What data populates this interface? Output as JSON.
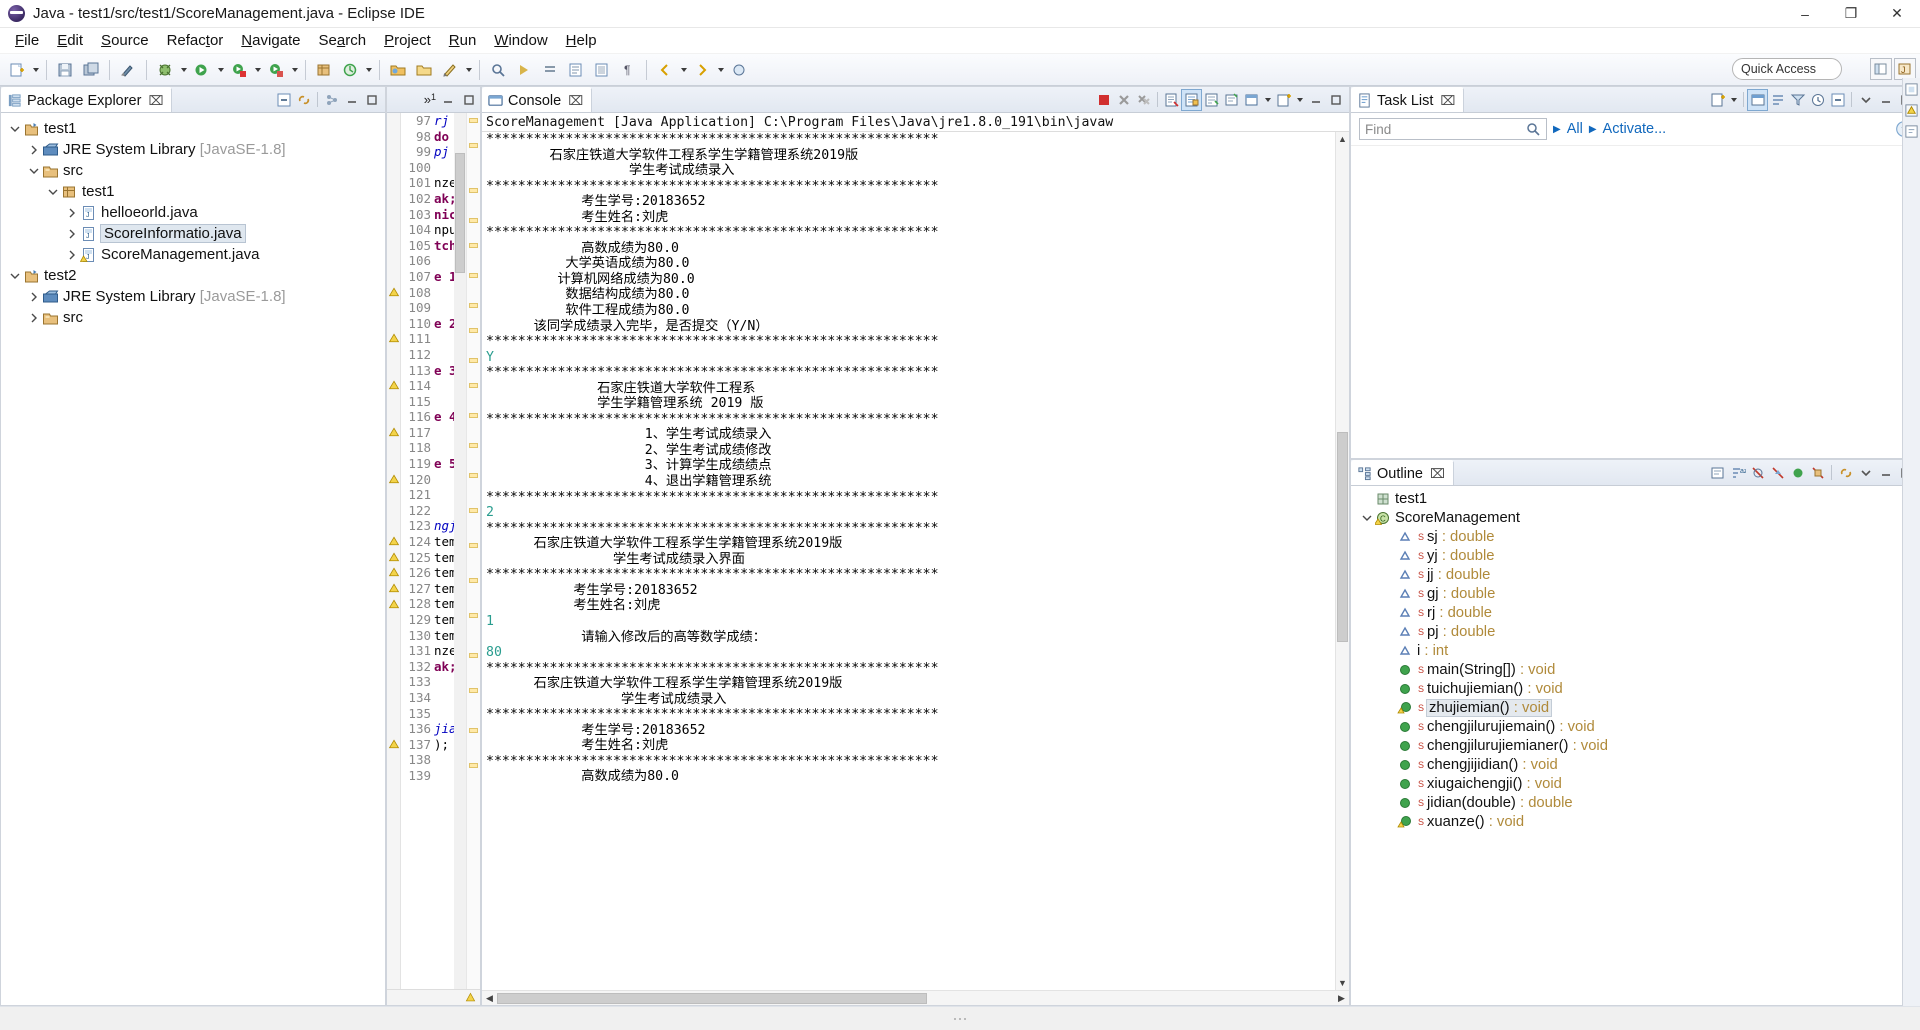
{
  "window": {
    "title": "Java - test1/src/test1/ScoreManagement.java - Eclipse IDE",
    "minimize": "–",
    "maximize": "❐",
    "close": "✕"
  },
  "menubar": [
    {
      "label": "File",
      "mnemonic": "F"
    },
    {
      "label": "Edit",
      "mnemonic": "E"
    },
    {
      "label": "Source",
      "mnemonic": "S"
    },
    {
      "label": "Refactor",
      "mnemonic": "t"
    },
    {
      "label": "Navigate",
      "mnemonic": "N"
    },
    {
      "label": "Search",
      "mnemonic": "a"
    },
    {
      "label": "Project",
      "mnemonic": "P"
    },
    {
      "label": "Run",
      "mnemonic": "R"
    },
    {
      "label": "Window",
      "mnemonic": "W"
    },
    {
      "label": "Help",
      "mnemonic": "H"
    }
  ],
  "toolbar": {
    "quick_access_placeholder": "Quick Access",
    "icons": [
      "new-java-project-icon",
      "save-icon",
      "save-all-icon",
      "quick-fix-icon",
      "debug-icon",
      "run-icon",
      "run-as-icon",
      "coverage-icon",
      "new-java-package-icon",
      "external-tools-icon",
      "open-type-icon",
      "open-task-icon",
      "edit-icon",
      "search-icon",
      "next-annotation-icon",
      "previous-annotation-icon",
      "last-edit-location-icon",
      "toggle-mark-occurrences-icon",
      "pilcrow-icon",
      "back-icon",
      "forward-icon"
    ]
  },
  "package_explorer": {
    "title": "Package Explorer",
    "close_label": "⌧",
    "tools": [
      "collapse-all-icon",
      "link-with-editor-icon",
      "view-menu-icon",
      "minimize-icon",
      "maximize-icon"
    ],
    "tree": [
      {
        "indent": 0,
        "twisty": "open",
        "icon": "java-project-icon",
        "label": "test1",
        "dim": "",
        "selected": false
      },
      {
        "indent": 1,
        "twisty": "closed",
        "icon": "jre-library-icon",
        "label": "JRE System Library",
        "dim": "[JavaSE-1.8]",
        "selected": false
      },
      {
        "indent": 1,
        "twisty": "open",
        "icon": "source-folder-icon",
        "label": "src",
        "dim": "",
        "selected": false
      },
      {
        "indent": 2,
        "twisty": "open",
        "icon": "package-icon",
        "label": "test1",
        "dim": "",
        "selected": false
      },
      {
        "indent": 3,
        "twisty": "closed",
        "icon": "java-file-icon",
        "label": "helloeorld.java",
        "dim": "",
        "selected": false
      },
      {
        "indent": 3,
        "twisty": "closed",
        "icon": "java-file-icon",
        "label": "ScoreInformatio.java",
        "dim": "",
        "selected": true
      },
      {
        "indent": 3,
        "twisty": "closed",
        "icon": "java-file-warn-icon",
        "label": "ScoreManagement.java",
        "dim": "",
        "selected": false
      },
      {
        "indent": 0,
        "twisty": "open",
        "icon": "java-project-icon",
        "label": "test2",
        "dim": "",
        "selected": false
      },
      {
        "indent": 1,
        "twisty": "closed",
        "icon": "jre-library-icon",
        "label": "JRE System Library",
        "dim": "[JavaSE-1.8]",
        "selected": false
      },
      {
        "indent": 1,
        "twisty": "closed",
        "icon": "source-folder-icon",
        "label": "src",
        "dim": "",
        "selected": false
      }
    ]
  },
  "editor": {
    "overflow_indicator": "»",
    "overflow_count": "1",
    "minimize": "–",
    "maximize": "❐",
    "lines": [
      {
        "num": "97",
        "code": "rj",
        "style": "fld"
      },
      {
        "num": "98",
        "code": "do",
        "style": "kw"
      },
      {
        "num": "99",
        "code": "pj",
        "style": "fld"
      },
      {
        "num": "100",
        "code": "",
        "style": ""
      },
      {
        "num": "101",
        "code": "nze",
        "style": ""
      },
      {
        "num": "102",
        "code": "ak;",
        "style": "kw"
      },
      {
        "num": "103",
        "code": "nic",
        "style": "kw"
      },
      {
        "num": "104",
        "code": "npu",
        "style": ""
      },
      {
        "num": "105",
        "code": "tch",
        "style": "kw"
      },
      {
        "num": "106",
        "code": "",
        "style": ""
      },
      {
        "num": "107",
        "code": "e 1",
        "style": "kw"
      },
      {
        "num": "108",
        "code": "",
        "style": ""
      },
      {
        "num": "109",
        "code": "",
        "style": ""
      },
      {
        "num": "110",
        "code": "e 2",
        "style": "kw"
      },
      {
        "num": "111",
        "code": "",
        "style": ""
      },
      {
        "num": "112",
        "code": "",
        "style": ""
      },
      {
        "num": "113",
        "code": "e 3",
        "style": "kw"
      },
      {
        "num": "114",
        "code": "",
        "style": ""
      },
      {
        "num": "115",
        "code": "",
        "style": ""
      },
      {
        "num": "116",
        "code": "e 4",
        "style": "kw"
      },
      {
        "num": "117",
        "code": "",
        "style": ""
      },
      {
        "num": "118",
        "code": "",
        "style": ""
      },
      {
        "num": "119",
        "code": "e 5",
        "style": "kw"
      },
      {
        "num": "120",
        "code": "",
        "style": ""
      },
      {
        "num": "121",
        "code": "",
        "style": ""
      },
      {
        "num": "122",
        "code": "",
        "style": ""
      },
      {
        "num": "123",
        "code": "ngj",
        "style": "fld"
      },
      {
        "num": "124",
        "code": "tem",
        "style": ""
      },
      {
        "num": "125",
        "code": "tem",
        "style": ""
      },
      {
        "num": "126",
        "code": "tem",
        "style": ""
      },
      {
        "num": "127",
        "code": "tem",
        "style": ""
      },
      {
        "num": "128",
        "code": "tem",
        "style": ""
      },
      {
        "num": "129",
        "code": "tem",
        "style": ""
      },
      {
        "num": "130",
        "code": "tem",
        "style": ""
      },
      {
        "num": "131",
        "code": "nze",
        "style": ""
      },
      {
        "num": "132",
        "code": "ak;",
        "style": "kw"
      },
      {
        "num": "133",
        "code": "",
        "style": ""
      },
      {
        "num": "134",
        "code": "",
        "style": ""
      },
      {
        "num": "135",
        "code": "",
        "style": ""
      },
      {
        "num": "136",
        "code": "jia",
        "style": "fld"
      },
      {
        "num": "137",
        "code": ");",
        "style": ""
      },
      {
        "num": "138",
        "code": "",
        "style": ""
      },
      {
        "num": "139",
        "code": "",
        "style": ""
      }
    ]
  },
  "console": {
    "title": "Console",
    "close_label": "⌧",
    "launch_config": "ScoreManagement [Java Application] C:\\Program Files\\Java\\jre1.8.0_191\\bin\\javaw",
    "tools": [
      "terminate-icon",
      "remove-launch-icon",
      "remove-all-terminated-icon",
      "clear-console-icon",
      "scroll-lock-icon",
      "pin-console-icon",
      "display-selected-console-icon",
      "open-console-icon",
      "minimize-icon",
      "maximize-icon"
    ],
    "output": [
      {
        "text": "*********************************************************",
        "type": "out"
      },
      {
        "text": "        石家庄铁道大学软件工程系学生学籍管理系统2019版",
        "type": "out"
      },
      {
        "text": "                  学生考试成绩录入",
        "type": "out"
      },
      {
        "text": "*********************************************************",
        "type": "out"
      },
      {
        "text": "            考生学号:20183652",
        "type": "out"
      },
      {
        "text": "            考生姓名:刘虎",
        "type": "out"
      },
      {
        "text": "*********************************************************",
        "type": "out"
      },
      {
        "text": "            高数成绩为80.0",
        "type": "out"
      },
      {
        "text": "          大学英语成绩为80.0",
        "type": "out"
      },
      {
        "text": "         计算机网络成绩为80.0",
        "type": "out"
      },
      {
        "text": "          数据结构成绩为80.0",
        "type": "out"
      },
      {
        "text": "          软件工程成绩为80.0",
        "type": "out"
      },
      {
        "text": "      该同学成绩录入完毕，是否提交（Y/N）",
        "type": "out"
      },
      {
        "text": "*********************************************************",
        "type": "out"
      },
      {
        "text": "Y",
        "type": "in"
      },
      {
        "text": "*********************************************************",
        "type": "out"
      },
      {
        "text": "              石家庄铁道大学软件工程系",
        "type": "out"
      },
      {
        "text": "              学生学籍管理系统 2019 版",
        "type": "out"
      },
      {
        "text": "*********************************************************",
        "type": "out"
      },
      {
        "text": "                    1、学生考试成绩录入",
        "type": "out"
      },
      {
        "text": "                    2、学生考试成绩修改",
        "type": "out"
      },
      {
        "text": "                    3、计算学生成绩绩点",
        "type": "out"
      },
      {
        "text": "                    4、退出学籍管理系统",
        "type": "out"
      },
      {
        "text": "*********************************************************",
        "type": "out"
      },
      {
        "text": "2",
        "type": "in"
      },
      {
        "text": "*********************************************************",
        "type": "out"
      },
      {
        "text": "      石家庄铁道大学软件工程系学生学籍管理系统2019版",
        "type": "out"
      },
      {
        "text": "                学生考试成绩录入界面",
        "type": "out"
      },
      {
        "text": "*********************************************************",
        "type": "out"
      },
      {
        "text": "           考生学号:20183652",
        "type": "out"
      },
      {
        "text": "           考生姓名:刘虎",
        "type": "out"
      },
      {
        "text": "1",
        "type": "in"
      },
      {
        "text": "            请输入修改后的高等数学成绩：",
        "type": "out"
      },
      {
        "text": "80",
        "type": "in"
      },
      {
        "text": "*********************************************************",
        "type": "out"
      },
      {
        "text": "      石家庄铁道大学软件工程系学生学籍管理系统2019版",
        "type": "out"
      },
      {
        "text": "                 学生考试成绩录入",
        "type": "out"
      },
      {
        "text": "*********************************************************",
        "type": "out"
      },
      {
        "text": "            考生学号:20183652",
        "type": "out"
      },
      {
        "text": "            考生姓名:刘虎",
        "type": "out"
      },
      {
        "text": "*********************************************************",
        "type": "out"
      },
      {
        "text": "            高数成绩为80.0",
        "type": "out"
      }
    ]
  },
  "task_list": {
    "title": "Task List",
    "close_label": "⌧",
    "find_placeholder": "Find",
    "all_label": "All",
    "activate_label": "Activate...",
    "tools": [
      "new-task-icon",
      "dropdown-icon",
      "focus-icon",
      "categorize-icon",
      "filter-icon",
      "schedule-icon",
      "collapse-all-icon",
      "view-menu-icon",
      "minimize-icon",
      "maximize-icon"
    ],
    "help_icon": "help-icon"
  },
  "outline": {
    "title": "Outline",
    "close_label": "⌧",
    "tools": [
      "focus-active-task-icon",
      "sort-icon",
      "hide-fields-icon",
      "hide-static-icon",
      "hide-nonpublic-icon",
      "hide-local-types-icon",
      "link-with-editor-icon",
      "view-menu-icon",
      "minimize-icon",
      "maximize-icon"
    ],
    "items": [
      {
        "indent": 0,
        "twisty": "none",
        "icon": "package-icon",
        "label": "test1",
        "type": "",
        "static": false,
        "selected": false
      },
      {
        "indent": 0,
        "twisty": "open",
        "icon": "class-warn-icon",
        "label": "ScoreManagement",
        "type": "",
        "static": false,
        "selected": false
      },
      {
        "indent": 1,
        "twisty": "none",
        "icon": "field-private-icon",
        "label": "sj",
        "type": " : double",
        "static": true,
        "selected": false
      },
      {
        "indent": 1,
        "twisty": "none",
        "icon": "field-private-icon",
        "label": "yj",
        "type": " : double",
        "static": true,
        "selected": false
      },
      {
        "indent": 1,
        "twisty": "none",
        "icon": "field-private-icon",
        "label": "jj",
        "type": " : double",
        "static": true,
        "selected": false
      },
      {
        "indent": 1,
        "twisty": "none",
        "icon": "field-private-icon",
        "label": "gj",
        "type": " : double",
        "static": true,
        "selected": false
      },
      {
        "indent": 1,
        "twisty": "none",
        "icon": "field-private-icon",
        "label": "rj",
        "type": " : double",
        "static": true,
        "selected": false
      },
      {
        "indent": 1,
        "twisty": "none",
        "icon": "field-private-icon",
        "label": "pj",
        "type": " : double",
        "static": true,
        "selected": false
      },
      {
        "indent": 1,
        "twisty": "none",
        "icon": "field-private-icon",
        "label": "i",
        "type": " : int",
        "static": false,
        "selected": false
      },
      {
        "indent": 1,
        "twisty": "none",
        "icon": "method-public-icon",
        "label": "main(String[])",
        "type": " : void",
        "static": true,
        "selected": false
      },
      {
        "indent": 1,
        "twisty": "none",
        "icon": "method-public-icon",
        "label": "tuichujiemian()",
        "type": " : void",
        "static": true,
        "selected": false
      },
      {
        "indent": 1,
        "twisty": "none",
        "icon": "method-warn-icon",
        "label": "zhujiemian()",
        "type": " : void",
        "static": true,
        "selected": true
      },
      {
        "indent": 1,
        "twisty": "none",
        "icon": "method-public-icon",
        "label": "chengjilurujiemain()",
        "type": " : void",
        "static": true,
        "selected": false
      },
      {
        "indent": 1,
        "twisty": "none",
        "icon": "method-public-icon",
        "label": "chengjilurujiemianer()",
        "type": " : void",
        "static": true,
        "selected": false
      },
      {
        "indent": 1,
        "twisty": "none",
        "icon": "method-public-icon",
        "label": "chengjijidian()",
        "type": " : void",
        "static": true,
        "selected": false
      },
      {
        "indent": 1,
        "twisty": "none",
        "icon": "method-public-icon",
        "label": "xiugaichengji()",
        "type": " : void",
        "static": true,
        "selected": false
      },
      {
        "indent": 1,
        "twisty": "none",
        "icon": "method-public-icon",
        "label": "jidian(double)",
        "type": " : double",
        "static": true,
        "selected": false
      },
      {
        "indent": 1,
        "twisty": "none",
        "icon": "method-warn-icon",
        "label": "xuanze()",
        "type": " : void",
        "static": true,
        "selected": false
      }
    ]
  },
  "colors": {
    "accent": "#1168bd",
    "console_input": "#2a9d8f",
    "selection": "#dfe7ef",
    "type_text": "#b08a3a"
  }
}
